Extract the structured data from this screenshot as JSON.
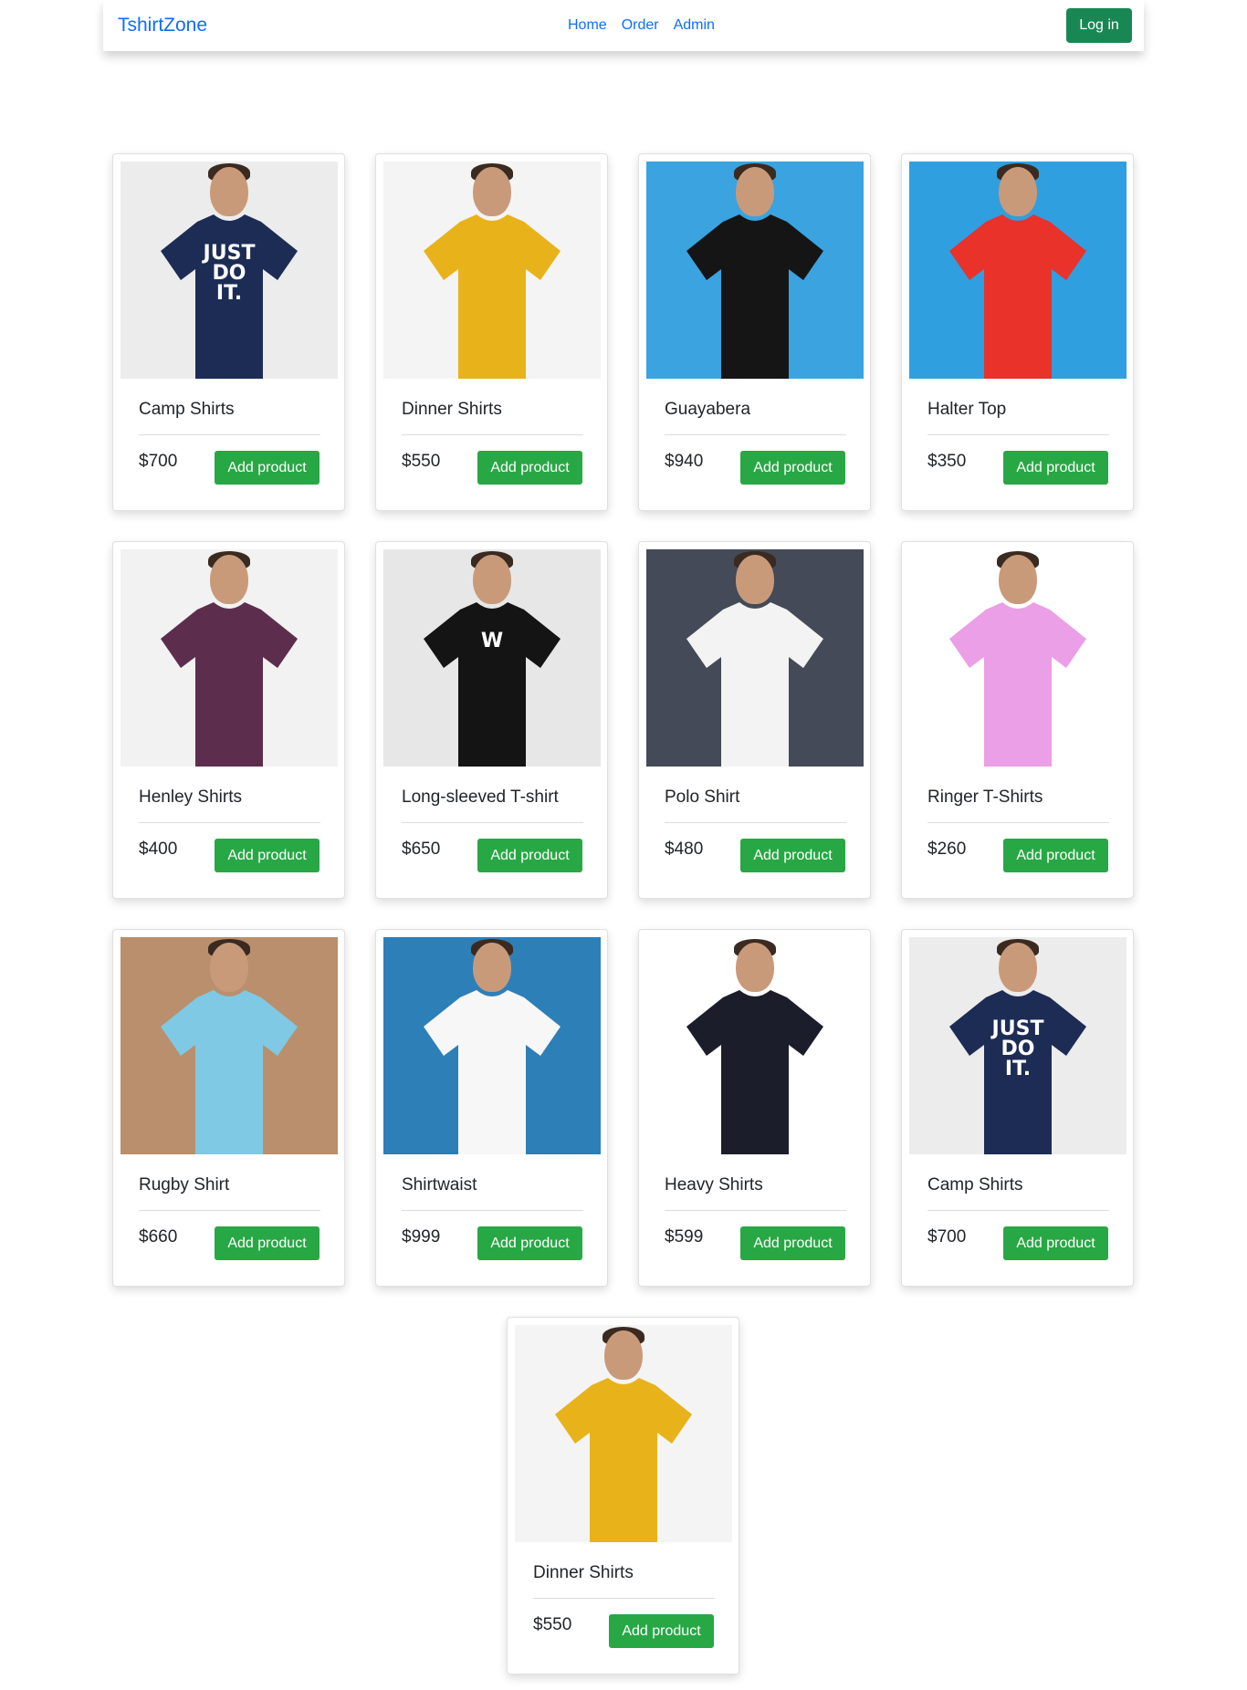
{
  "navbar": {
    "brand": "TshirtZone",
    "links": [
      "Home",
      "Order",
      "Admin"
    ],
    "login_label": "Log in"
  },
  "products": [
    {
      "name": "Camp Shirts",
      "price": "$700",
      "button": "Add product",
      "image": {
        "bg": "#ececec",
        "shirt": "#1d2c55",
        "print": "JUST DO IT."
      }
    },
    {
      "name": "Dinner Shirts",
      "price": "$550",
      "button": "Add product",
      "image": {
        "bg": "#f4f4f4",
        "shirt": "#e8b21a",
        "print": ""
      }
    },
    {
      "name": "Guayabera",
      "price": "$940",
      "button": "Add product",
      "image": {
        "bg": "#3aa3e0",
        "shirt": "#151515",
        "print": ""
      }
    },
    {
      "name": "Halter Top",
      "price": "$350",
      "button": "Add product",
      "image": {
        "bg": "#2f9fe0",
        "shirt": "#e8322a",
        "print": ""
      }
    },
    {
      "name": "Henley Shirts",
      "price": "$400",
      "button": "Add product",
      "image": {
        "bg": "#f2f2f2",
        "shirt": "#5d2d4e",
        "print": ""
      }
    },
    {
      "name": "Long-sleeved T-shirt",
      "price": "$650",
      "button": "Add product",
      "image": {
        "bg": "#e7e7e7",
        "shirt": "#141414",
        "print": "W"
      }
    },
    {
      "name": "Polo Shirt",
      "price": "$480",
      "button": "Add product",
      "image": {
        "bg": "#444a57",
        "shirt": "#f3f3f3",
        "print": ""
      }
    },
    {
      "name": "Ringer T-Shirts",
      "price": "$260",
      "button": "Add product",
      "image": {
        "bg": "#ffffff",
        "shirt": "#ea9fe6",
        "print": ""
      }
    },
    {
      "name": "Rugby Shirt",
      "price": "$660",
      "button": "Add product",
      "image": {
        "bg": "#b98f6d",
        "shirt": "#7fc9e4",
        "print": ""
      }
    },
    {
      "name": "Shirtwaist",
      "price": "$999",
      "button": "Add product",
      "image": {
        "bg": "#2d7fb8",
        "shirt": "#f7f7f7",
        "print": ""
      }
    },
    {
      "name": "Heavy Shirts",
      "price": "$599",
      "button": "Add product",
      "image": {
        "bg": "#ffffff",
        "shirt": "#1b1e2a",
        "print": ""
      }
    },
    {
      "name": "Camp Shirts",
      "price": "$700",
      "button": "Add product",
      "image": {
        "bg": "#ececec",
        "shirt": "#1d2c55",
        "print": "JUST DO IT."
      }
    },
    {
      "name": "Dinner Shirts",
      "price": "$550",
      "button": "Add product",
      "image": {
        "bg": "#f4f4f4",
        "shirt": "#e8b21a",
        "print": ""
      }
    }
  ],
  "colors": {
    "primary": "#0d6efd",
    "success": "#28a745"
  }
}
